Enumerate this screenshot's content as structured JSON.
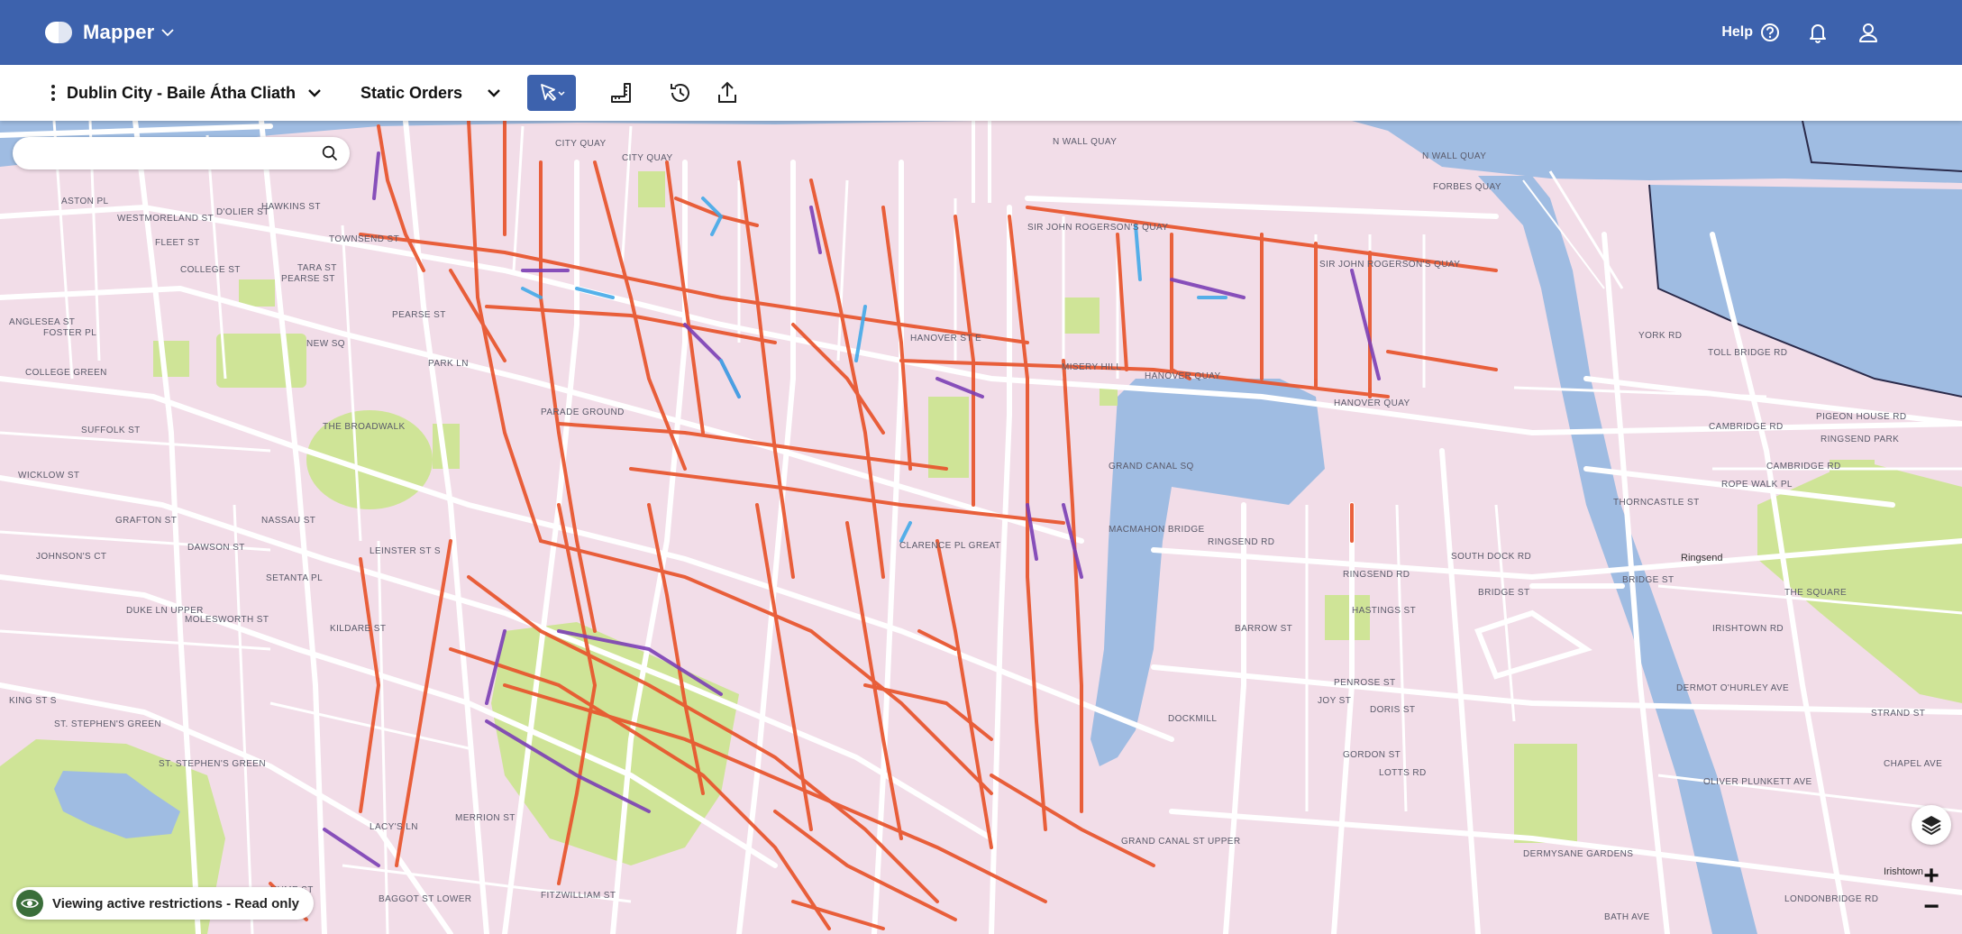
{
  "app": {
    "title": "Mapper",
    "help_label": "Help",
    "icons": [
      "mapper-logo-icon",
      "chevron-down-icon",
      "help-icon",
      "bell-icon",
      "user-icon"
    ]
  },
  "toolbar": {
    "city": "Dublin City - Baile Átha Cliath",
    "orders": "Static Orders",
    "tools": [
      "select-pointer-icon",
      "measure-ruler-icon",
      "history-icon",
      "export-icon"
    ]
  },
  "search": {
    "placeholder": "",
    "value": ""
  },
  "status": {
    "text": "Viewing active restrictions - Read only"
  },
  "map": {
    "labels": [
      "CITY QUAY",
      "N WALL QUAY",
      "N WALL QUAY",
      "SIR JOHN ROGERSON'S QUAY",
      "SIR JOHN ROGERSON'S QUAY",
      "TOWNSEND ST",
      "PEARSE ST",
      "PEARSE ST",
      "NEW SQ",
      "COLLEGE GREEN",
      "COLLEGE ST",
      "FLEET ST",
      "WESTMORELAND ST",
      "D'OLIER ST",
      "HAWKINS ST",
      "TARA ST",
      "PARK LN",
      "THE BROADWALK",
      "NASSAU ST",
      "LEINSTER ST S",
      "SETANTA PL",
      "MOLESWORTH ST",
      "KILDARE ST",
      "DAWSON ST",
      "GRAFTON ST",
      "WICKLOW ST",
      "JOHNSON'S CT",
      "DUKE LN UPPER",
      "SUFFOLK ST",
      "ANGLESEA ST",
      "FOSTER PL",
      "ASTON PL",
      "KING ST S",
      "ST. STEPHEN'S GREEN",
      "ST. STEPHEN'S GREEN",
      "HUME ST",
      "BAGGOT ST LOWER",
      "FITZWILLIAM ST",
      "LACY'S LN",
      "MERRION ST",
      "HANOVER ST E",
      "HANOVER QUAY",
      "HANOVER QUAY",
      "MISERY HILL",
      "GRAND CANAL SQ",
      "MACMAHON BRIDGE",
      "RINGSEND RD",
      "RINGSEND RD",
      "HASTINGS ST",
      "BARROW ST",
      "GRAND CANAL ST UPPER",
      "CLARENCE PL GREAT",
      "DOCKMILL",
      "PENROSE ST",
      "DORIS ST",
      "JOY ST",
      "GORDON ST",
      "LOTTS RD",
      "BRIDGE ST",
      "BRIDGE ST",
      "YORK RD",
      "TOLL BRIDGE RD",
      "CAMBRIDGE RD",
      "CAMBRIDGE RD",
      "ROPE WALK PL",
      "PIGEON HOUSE RD",
      "RINGSEND PARK",
      "THORNCASTLE ST",
      "IRISHTOWN RD",
      "THE SQUARE",
      "DERMOT O'HURLEY AVE",
      "OLIVER PLUNKETT AVE",
      "STRAND ST",
      "CHAPEL AVE",
      "LONDONBRIDGE RD",
      "BATH AVE",
      "DERMYSANE GARDENS",
      "FORBES QUAY",
      "SOUTH DOCK RD",
      "PARADE GROUND",
      "CITY QUAY"
    ],
    "place_labels": [
      "Ringsend",
      "Irishtown"
    ],
    "colors": {
      "land": "#f2dde8",
      "water": "#9fbce2",
      "park": "#cfe497",
      "restriction_primary": "#e8542c",
      "restriction_secondary": "#7b3fb5",
      "restriction_tertiary": "#43a8e8"
    }
  },
  "map_controls": {
    "layers_icon": "layers-icon",
    "zoom_in": "+",
    "zoom_out": "−"
  }
}
